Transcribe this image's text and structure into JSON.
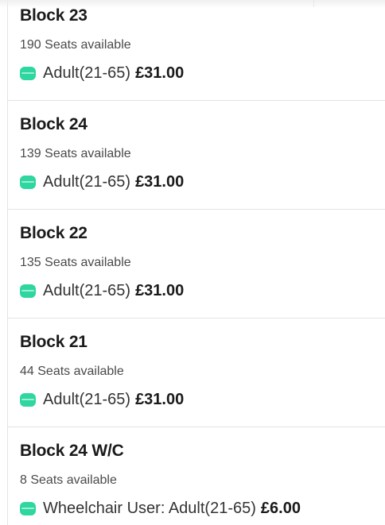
{
  "blocks": [
    {
      "name": "Block 23",
      "seats": "190 Seats available",
      "ticket_type": "Adult(21-65)",
      "price": "£31.00"
    },
    {
      "name": "Block 24",
      "seats": "139 Seats available",
      "ticket_type": "Adult(21-65)",
      "price": "£31.00"
    },
    {
      "name": "Block 22",
      "seats": "135 Seats available",
      "ticket_type": "Adult(21-65)",
      "price": "£31.00"
    },
    {
      "name": "Block 21",
      "seats": "44 Seats available",
      "ticket_type": "Adult(21-65)",
      "price": "£31.00"
    },
    {
      "name": "Block 24 W/C",
      "seats": "8 Seats available",
      "ticket_type": "Wheelchair User: Adult(21-65)",
      "price": "£6.00"
    }
  ],
  "colors": {
    "ticket_icon": "#2ed6a0"
  },
  "icons": {
    "ticket": "ticket-icon"
  }
}
